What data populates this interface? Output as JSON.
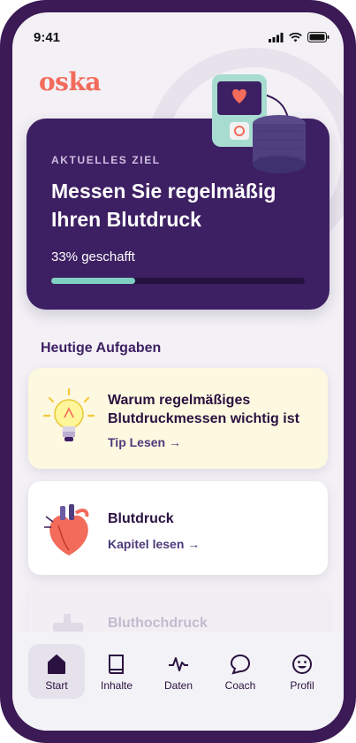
{
  "status": {
    "time": "9:41"
  },
  "brand": {
    "logo": "oska"
  },
  "goal": {
    "kicker": "AKTUELLES ZIEL",
    "title": "Messen Sie regelmäßig Ihren Blutdruck",
    "progress_text": "33% geschafft",
    "progress_fraction": 0.33
  },
  "tasks": {
    "section_title": "Heutige Aufgaben",
    "items": [
      {
        "title": "Warum regelmäßiges Blutdruckmessen wichtig ist",
        "link": "Tip Lesen →",
        "icon": "lightbulb-icon"
      },
      {
        "title": "Blutdruck",
        "link": "Kapitel lesen →",
        "icon": "heart-icon"
      },
      {
        "title": "Bluthochdruck",
        "icon": "device-icon"
      }
    ]
  },
  "tabbar": {
    "items": [
      {
        "label": "Start",
        "icon": "home-icon",
        "active": true
      },
      {
        "label": "Inhalte",
        "icon": "book-icon"
      },
      {
        "label": "Daten",
        "icon": "pulse-icon"
      },
      {
        "label": "Coach",
        "icon": "chat-icon"
      },
      {
        "label": "Profil",
        "icon": "smiley-icon"
      }
    ]
  },
  "colors": {
    "accent": "#3d1f63",
    "brand": "#f26b5b",
    "progress": "#7fd0c2"
  }
}
